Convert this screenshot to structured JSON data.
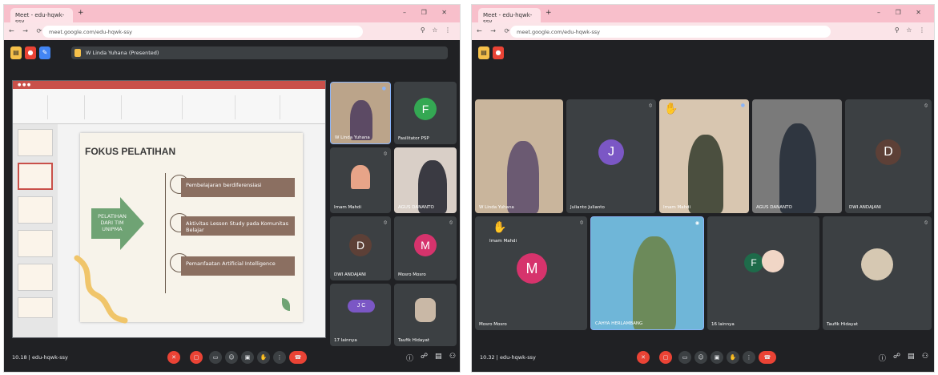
{
  "colors": {
    "accent": "#ea4335",
    "pill_red": "#ea4335",
    "tab_bar": "#f8bfcb",
    "slide_arrow": "#6fa374",
    "slide_item": "#8b6f61"
  },
  "left": {
    "browser": {
      "tab_title": "Meet - edu-hqwk-ssy",
      "url": "meet.google.com/edu-hqwk-ssy",
      "window_controls": "– ❐ ✕"
    },
    "meet": {
      "presenting": "W Linda Yuhana (Presented)",
      "slide": {
        "title": "FOKUS PELATIHAN",
        "arrow_text": "PELATIHAN DARI TIM UNIPMA",
        "items": [
          "Pembelajaran berdiferensiasi",
          "Aktivitas Lesson Study pada Komunitas Belajar",
          "Pemanfaatan Artificial Intelligence"
        ]
      },
      "tiles": [
        {
          "name": "W Linda Yuhana",
          "type": "camera"
        },
        {
          "name": "Fasilitator PSP",
          "type": "avatar",
          "initial": "F",
          "color": "#34a853"
        },
        {
          "name": "Imam Mahdi",
          "type": "camera"
        },
        {
          "name": "AGUS DANANTO",
          "type": "camera"
        },
        {
          "name": "DWI ANDAJANI",
          "type": "avatar",
          "initial": "D",
          "color": "#5d4037"
        },
        {
          "name": "Mosro Mosro",
          "type": "avatar",
          "initial": "M",
          "color": "#d6336c"
        },
        {
          "name": "17 lainnya",
          "type": "avatar",
          "initial": "J C",
          "color": "#7b57c5"
        },
        {
          "name": "Taufik Hidayat",
          "type": "camera"
        }
      ],
      "time": "10.18",
      "meeting_code": "edu-hqwk-ssy"
    }
  },
  "right": {
    "browser": {
      "tab_title": "Meet - edu-hqwk-ssy",
      "url": "meet.google.com/edu-hqwk-ssy",
      "window_controls": "– ❐ ✕"
    },
    "meet": {
      "tiles": [
        {
          "name": "W Linda Yuhana",
          "type": "camera"
        },
        {
          "name": "Julianto Julianto",
          "type": "avatar",
          "initial": "J",
          "color": "#7b57c5"
        },
        {
          "name": "Imam Mahdi",
          "type": "camera"
        },
        {
          "name": "AGUS DANANTO",
          "type": "camera"
        },
        {
          "name": "DWI ANDAJANI",
          "type": "avatar",
          "initial": "D",
          "color": "#5d4037"
        },
        {
          "name": "Mosro Mosro",
          "type": "avatar",
          "initial": "M",
          "color": "#d6336c"
        },
        {
          "name": "CAHYA HERLAMBANG",
          "type": "camera"
        },
        {
          "name": "16 lainnya",
          "type": "avatar",
          "initial": "F",
          "color": "#1e6b4a"
        },
        {
          "name": "Taufik Hidayat",
          "type": "camera"
        }
      ],
      "raised_hand_label": "Imam Mahdi",
      "time": "10.32",
      "meeting_code": "edu-hqwk-ssy"
    }
  },
  "icons": [
    "mic-off-icon",
    "camera-off-icon",
    "captions-icon",
    "emoji-icon",
    "present-icon",
    "hand-icon",
    "more-icon",
    "end-call-icon",
    "info-icon",
    "people-icon",
    "chat-icon",
    "activities-icon"
  ]
}
